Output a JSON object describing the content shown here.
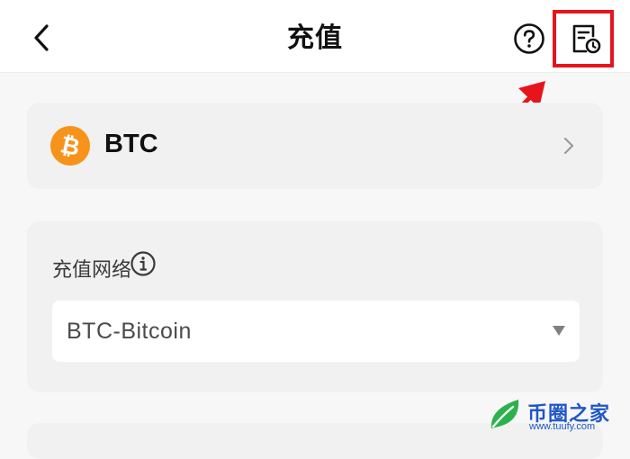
{
  "header": {
    "title": "充值",
    "back_icon": "chevron-left-icon",
    "help_icon": "question-circle-icon",
    "record_icon": "deposit-record-icon"
  },
  "highlight": {
    "color": "#e8141b",
    "target": "deposit-record-icon"
  },
  "coin": {
    "name": "BTC",
    "logo_symbol": "₿",
    "logo_color": "#f7931a"
  },
  "network": {
    "label": "充值网络",
    "selected": "BTC-Bitcoin"
  },
  "watermark": {
    "name": "币圈之家",
    "url": "www.tuufy.com"
  }
}
